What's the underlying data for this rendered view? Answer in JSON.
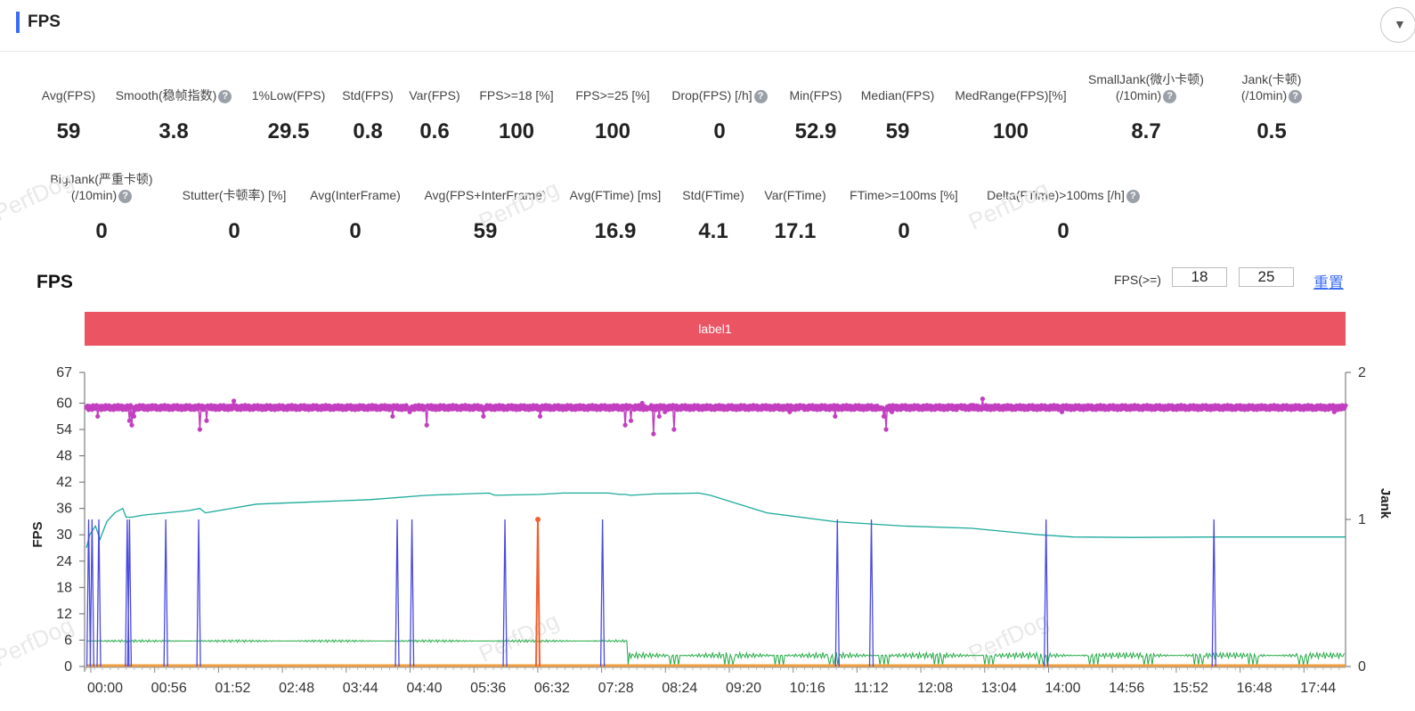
{
  "header": {
    "title": "FPS",
    "collapse_icon": "chevron-down-icon"
  },
  "stats_row1": [
    {
      "label": "Avg(FPS)",
      "value": "59",
      "help": false
    },
    {
      "label": "Smooth(稳帧指数)",
      "value": "3.8",
      "help": true
    },
    {
      "label": "1%Low(FPS)",
      "value": "29.5",
      "help": false
    },
    {
      "label": "Std(FPS)",
      "value": "0.8",
      "help": false
    },
    {
      "label": "Var(FPS)",
      "value": "0.6",
      "help": false
    },
    {
      "label": "FPS>=18 [%]",
      "value": "100",
      "help": false
    },
    {
      "label": "FPS>=25 [%]",
      "value": "100",
      "help": false
    },
    {
      "label": "Drop(FPS) [/h]",
      "value": "0",
      "help": true
    },
    {
      "label": "Min(FPS)",
      "value": "52.9",
      "help": false
    },
    {
      "label": "Median(FPS)",
      "value": "59",
      "help": false
    },
    {
      "label": "MedRange(FPS)[%]",
      "value": "100",
      "help": false
    },
    {
      "label": "SmallJank(微小卡顿)",
      "label2": "(/10min)",
      "value": "8.7",
      "help": true
    },
    {
      "label": "Jank(卡顿)",
      "label2": "(/10min)",
      "value": "0.5",
      "help": true
    }
  ],
  "stats_row2": [
    {
      "label": "BigJank(严重卡顿)",
      "label2": "(/10min)",
      "value": "0",
      "help": true
    },
    {
      "label": "Stutter(卡顿率) [%]",
      "value": "0",
      "help": false
    },
    {
      "label": "Avg(InterFrame)",
      "value": "0",
      "help": false
    },
    {
      "label": "Avg(FPS+InterFrame)",
      "value": "59",
      "help": false
    },
    {
      "label": "Avg(FTime) [ms]",
      "value": "16.9",
      "help": false
    },
    {
      "label": "Std(FTime)",
      "value": "4.1",
      "help": false
    },
    {
      "label": "Var(FTime)",
      "value": "17.1",
      "help": false
    },
    {
      "label": "FTime>=100ms [%]",
      "value": "0",
      "help": false
    },
    {
      "label": "Delta(FTime)>100ms [/h]",
      "value": "0",
      "help": true
    }
  ],
  "watermark": "PerfDog",
  "chart_section": {
    "title": "FPS",
    "threshold_label": "FPS(>=)",
    "threshold1": "18",
    "threshold2": "25",
    "reset_label": "重置",
    "label_band": "label1"
  },
  "colors": {
    "accent": "#3b6cf6",
    "label_band": "#eb5463",
    "fps_series": "#c23fbf",
    "jank_series": "#4a4ae0",
    "bigjank_series": "#f06030",
    "teal_series": "#1aaa9b",
    "green_series": "#22aa44",
    "orange_base": "#f0a040"
  },
  "chart_data": {
    "type": "line",
    "xlabel": "",
    "ylabel": "FPS",
    "y2label": "Jank",
    "ylim": [
      0,
      67
    ],
    "y2lim": [
      0,
      2
    ],
    "yticks": [
      "0",
      "6",
      "12",
      "18",
      "24",
      "30",
      "36",
      "42",
      "48",
      "54",
      "60",
      "67"
    ],
    "y2ticks": [
      "0",
      "1",
      "2"
    ],
    "xticks": [
      "00:00",
      "00:56",
      "01:52",
      "02:48",
      "03:44",
      "04:40",
      "05:36",
      "06:32",
      "07:28",
      "08:24",
      "09:20",
      "10:16",
      "11:12",
      "12:08",
      "13:04",
      "14:00",
      "14:56",
      "15:52",
      "16:48",
      "17:44"
    ],
    "x_range_seconds": [
      0,
      1110
    ],
    "fps": {
      "baseline": 59,
      "dips": [
        [
          10,
          57
        ],
        [
          38,
          56
        ],
        [
          40,
          55
        ],
        [
          42,
          57
        ],
        [
          100,
          54
        ],
        [
          106,
          56
        ],
        [
          130,
          60.5
        ],
        [
          270,
          57
        ],
        [
          285,
          58
        ],
        [
          300,
          55
        ],
        [
          350,
          57
        ],
        [
          400,
          57
        ],
        [
          470,
          59
        ],
        [
          475,
          55
        ],
        [
          480,
          56
        ],
        [
          490,
          60
        ],
        [
          495,
          59
        ],
        [
          500,
          53
        ],
        [
          505,
          57
        ],
        [
          510,
          58
        ],
        [
          518,
          54
        ],
        [
          620,
          58
        ],
        [
          630,
          59
        ],
        [
          660,
          57
        ],
        [
          700,
          59
        ],
        [
          703,
          57
        ],
        [
          705,
          54
        ],
        [
          710,
          58
        ],
        [
          770,
          59
        ],
        [
          780,
          59.5
        ],
        [
          790,
          61
        ],
        [
          860,
          58
        ],
        [
          1100,
          58
        ]
      ]
    },
    "teal_series": [
      [
        0,
        27
      ],
      [
        3,
        30
      ],
      [
        8,
        32
      ],
      [
        12,
        29
      ],
      [
        18,
        33
      ],
      [
        25,
        35
      ],
      [
        32,
        36
      ],
      [
        35,
        34
      ],
      [
        40,
        34
      ],
      [
        50,
        34.5
      ],
      [
        70,
        35
      ],
      [
        90,
        35.5
      ],
      [
        100,
        36
      ],
      [
        105,
        35
      ],
      [
        150,
        37
      ],
      [
        200,
        37.5
      ],
      [
        250,
        38
      ],
      [
        300,
        39
      ],
      [
        355,
        39.5
      ],
      [
        360,
        39
      ],
      [
        400,
        39.2
      ],
      [
        420,
        39.5
      ],
      [
        460,
        39.5
      ],
      [
        470,
        39.2
      ],
      [
        475,
        39.2
      ],
      [
        480,
        39
      ],
      [
        500,
        39.3
      ],
      [
        540,
        39.5
      ],
      [
        550,
        39
      ],
      [
        600,
        35
      ],
      [
        660,
        33
      ],
      [
        720,
        32
      ],
      [
        780,
        31.5
      ],
      [
        840,
        30
      ],
      [
        870,
        29.5
      ],
      [
        920,
        29.4
      ],
      [
        1000,
        29.5
      ],
      [
        1110,
        29.5
      ]
    ],
    "green_series": {
      "early_level": 5.8,
      "late_level": 2.5,
      "switch_at": 477
    },
    "jank_spikes": [
      2,
      5,
      11,
      36,
      38,
      70,
      99,
      274,
      287,
      369,
      398,
      455,
      662,
      692,
      846,
      994
    ],
    "bigjank_spikes": [
      398
    ],
    "jank_spike_value": 1,
    "bigjank_spike_value": 1.0
  }
}
